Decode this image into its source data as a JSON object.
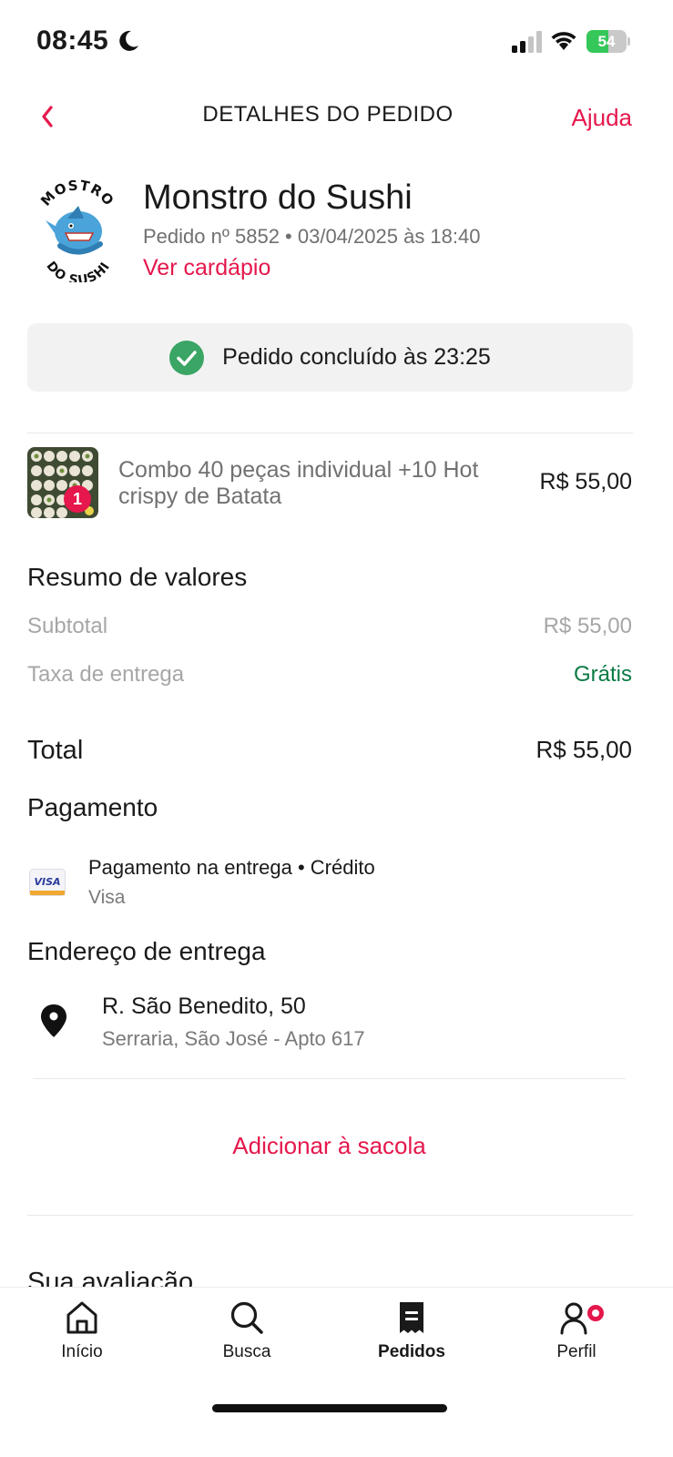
{
  "status_bar": {
    "time": "08:45",
    "battery": "54",
    "battery_level": 0.54
  },
  "header": {
    "title": "DETALHES DO PEDIDO",
    "help": "Ajuda"
  },
  "store": {
    "logo_text_top": "MOSTRO",
    "logo_text_bottom": "DO SUSHI",
    "name": "Monstro do Sushi",
    "meta": "Pedido nº 5852 • 03/04/2025 às 18:40",
    "menu_link": "Ver cardápio"
  },
  "order_status": {
    "text": "Pedido concluído às 23:25",
    "icon": "check-circle-icon",
    "color": "#3aa564"
  },
  "item": {
    "quantity": "1",
    "name": "Combo 40 peças individual +10 Hot crispy de Batata",
    "price": "R$ 55,00"
  },
  "summary": {
    "title": "Resumo de valores",
    "subtotal_label": "Subtotal",
    "subtotal_value": "R$ 55,00",
    "delivery_label": "Taxa de entrega",
    "delivery_value": "Grátis",
    "total_label": "Total",
    "total_value": "R$ 55,00"
  },
  "payment": {
    "title": "Pagamento",
    "card_brand_badge": "VISA",
    "method": "Pagamento na entrega • Crédito",
    "brand": "Visa"
  },
  "address": {
    "title": "Endereço de entrega",
    "street": "R. São Benedito, 50",
    "detail": "Serraria, São José - Apto 617"
  },
  "actions": {
    "add_to_bag": "Adicionar à sacola"
  },
  "next_section": {
    "title": "Sua avaliação"
  },
  "bottom_nav": {
    "items": [
      {
        "label": "Início",
        "icon": "home-icon",
        "active": false
      },
      {
        "label": "Busca",
        "icon": "search-icon",
        "active": false
      },
      {
        "label": "Pedidos",
        "icon": "receipt-icon",
        "active": true
      },
      {
        "label": "Perfil",
        "icon": "profile-icon",
        "active": false
      }
    ]
  },
  "colors": {
    "brand": "#e5174c",
    "success": "#3aa564",
    "free": "#0a7a44"
  }
}
